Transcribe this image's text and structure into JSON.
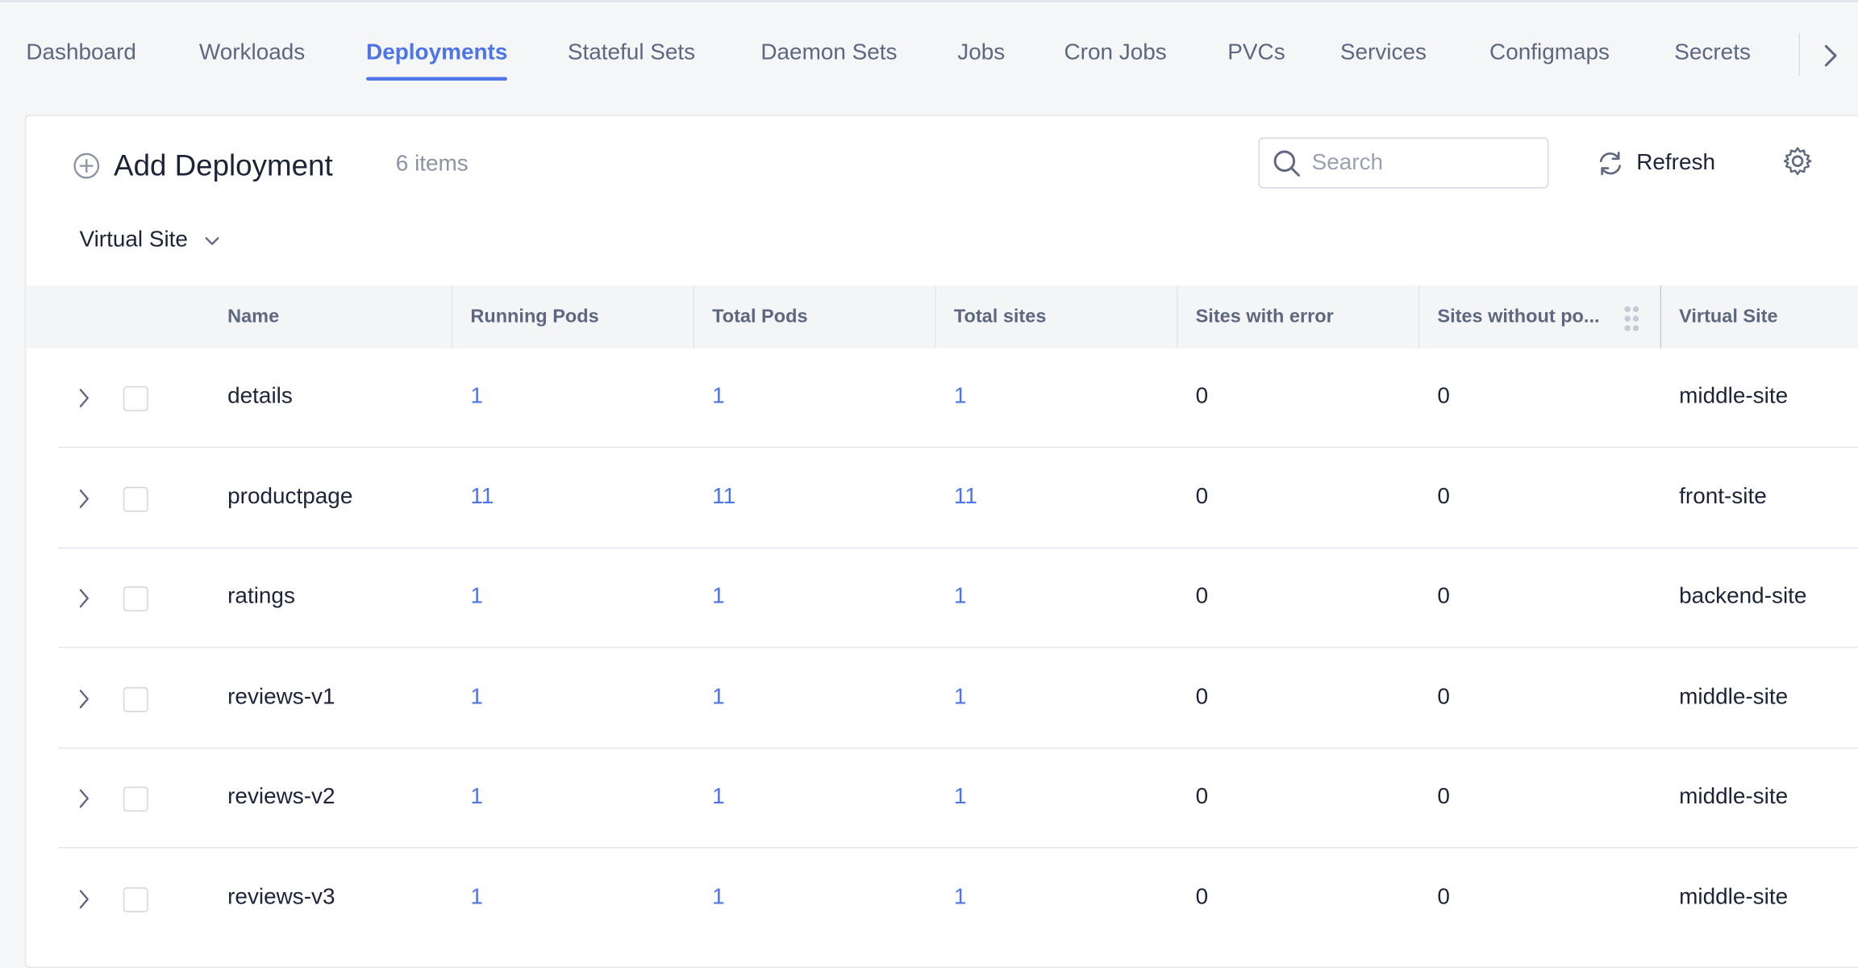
{
  "tabs": [
    {
      "label": "Dashboard",
      "active": false
    },
    {
      "label": "Workloads",
      "active": false
    },
    {
      "label": "Deployments",
      "active": true
    },
    {
      "label": "Stateful Sets",
      "active": false
    },
    {
      "label": "Daemon Sets",
      "active": false
    },
    {
      "label": "Jobs",
      "active": false
    },
    {
      "label": "Cron Jobs",
      "active": false
    },
    {
      "label": "PVCs",
      "active": false
    },
    {
      "label": "Services",
      "active": false
    },
    {
      "label": "Configmaps",
      "active": false
    },
    {
      "label": "Secrets",
      "active": false
    }
  ],
  "toolbar": {
    "add_label": "Add Deployment",
    "count_label": "6 items",
    "search_placeholder": "Search",
    "search_value": "",
    "refresh_label": "Refresh",
    "filter_label": "Virtual Site"
  },
  "table": {
    "columns": [
      "Name",
      "Running Pods",
      "Total Pods",
      "Total sites",
      "Sites with error",
      "Sites without po...",
      "Virtual Site"
    ],
    "rows": [
      {
        "name": "details",
        "running_pods": "1",
        "total_pods": "1",
        "total_sites": "1",
        "sites_with_error": "0",
        "sites_without_pods": "0",
        "virtual_site": "middle-site"
      },
      {
        "name": "productpage",
        "running_pods": "11",
        "total_pods": "11",
        "total_sites": "11",
        "sites_with_error": "0",
        "sites_without_pods": "0",
        "virtual_site": "front-site"
      },
      {
        "name": "ratings",
        "running_pods": "1",
        "total_pods": "1",
        "total_sites": "1",
        "sites_with_error": "0",
        "sites_without_pods": "0",
        "virtual_site": "backend-site"
      },
      {
        "name": "reviews-v1",
        "running_pods": "1",
        "total_pods": "1",
        "total_sites": "1",
        "sites_with_error": "0",
        "sites_without_pods": "0",
        "virtual_site": "middle-site"
      },
      {
        "name": "reviews-v2",
        "running_pods": "1",
        "total_pods": "1",
        "total_sites": "1",
        "sites_with_error": "0",
        "sites_without_pods": "0",
        "virtual_site": "middle-site"
      },
      {
        "name": "reviews-v3",
        "running_pods": "1",
        "total_pods": "1",
        "total_sites": "1",
        "sites_with_error": "0",
        "sites_without_pods": "0",
        "virtual_site": "middle-site"
      }
    ]
  },
  "colors": {
    "accent": "#4d74e8",
    "text": "#1d2438",
    "muted": "#5e6780",
    "background": "#f5f6f8"
  },
  "icons": {
    "add": "plus-circle-icon",
    "search": "search-icon",
    "refresh": "refresh-icon",
    "settings": "gear-icon",
    "filter": "chevron-down-icon",
    "expand": "chevron-right-icon",
    "tab_scroll": "chevron-right-icon",
    "column_drag": "drag-handle-icon"
  }
}
